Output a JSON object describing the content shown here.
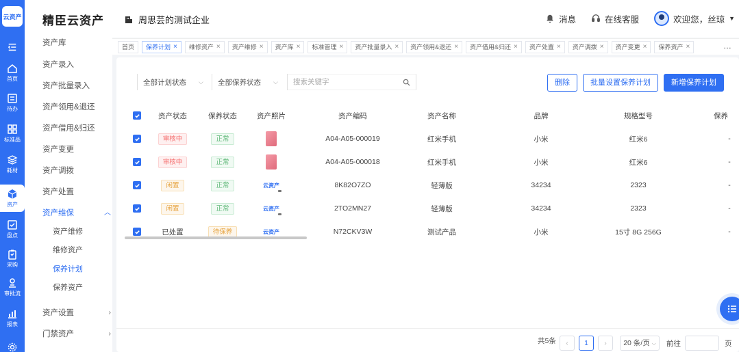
{
  "app": {
    "logo_text": "云资产",
    "brand": "精臣云资产",
    "company": "周思芸的测试企业"
  },
  "header": {
    "messages": "消息",
    "support": "在线客服",
    "welcome": "欢迎您，丝琼"
  },
  "rail": [
    {
      "label": "首页",
      "icon": "home-icon"
    },
    {
      "label": "待办",
      "icon": "todo-icon"
    },
    {
      "label": "标准品",
      "icon": "grid-icon"
    },
    {
      "label": "耗材",
      "icon": "layers-icon"
    },
    {
      "label": "资产",
      "icon": "cube-icon"
    },
    {
      "label": "盘点",
      "icon": "inventory-icon"
    },
    {
      "label": "采购",
      "icon": "clipboard-icon"
    },
    {
      "label": "审批流",
      "icon": "approval-icon"
    },
    {
      "label": "报表",
      "icon": "chart-icon"
    },
    {
      "label": "",
      "icon": "settings-icon"
    }
  ],
  "sidebar": {
    "items": [
      {
        "label": "资产库"
      },
      {
        "label": "资产录入"
      },
      {
        "label": "资产批量录入"
      },
      {
        "label": "资产领用&退还"
      },
      {
        "label": "资产借用&归还"
      },
      {
        "label": "资产变更"
      },
      {
        "label": "资产调拨"
      },
      {
        "label": "资产处置"
      },
      {
        "label": "资产维保"
      },
      {
        "label": "资产设置"
      },
      {
        "label": "门禁资产"
      }
    ],
    "subitems": [
      {
        "label": "资产维修"
      },
      {
        "label": "维修资产"
      },
      {
        "label": "保养计划"
      },
      {
        "label": "保养资产"
      }
    ]
  },
  "tabs": [
    {
      "label": "首页",
      "closable": false
    },
    {
      "label": "保养计划",
      "closable": true
    },
    {
      "label": "维修资产",
      "closable": true
    },
    {
      "label": "资产维修",
      "closable": true
    },
    {
      "label": "资产库",
      "closable": true
    },
    {
      "label": "标准管理",
      "closable": true
    },
    {
      "label": "资产批量录入",
      "closable": true
    },
    {
      "label": "资产领用&退还",
      "closable": true
    },
    {
      "label": "资产借用&归还",
      "closable": true
    },
    {
      "label": "资产处置",
      "closable": true
    },
    {
      "label": "资产调拨",
      "closable": true
    },
    {
      "label": "资产变更",
      "closable": true
    },
    {
      "label": "保养资产",
      "closable": true
    }
  ],
  "tabs_more": "…",
  "filters": {
    "plan_status": "全部计划状态",
    "maint_status": "全部保养状态",
    "search_placeholder": "搜索关键字"
  },
  "buttons": {
    "delete": "删除",
    "batch": "批量设置保养计划",
    "create": "新增保养计划"
  },
  "table": {
    "headers": [
      "资产状态",
      "保养状态",
      "资产照片",
      "资产编码",
      "资产名称",
      "品牌",
      "规格型号",
      "保养"
    ],
    "rows": [
      {
        "status": "审核中",
        "status_tone": "red",
        "maint": "正常",
        "maint_tone": "green",
        "photo": "phone",
        "code": "A04-A05-000019",
        "name": "红米手机",
        "brand": "小米",
        "model": "红米6",
        "extra": "-"
      },
      {
        "status": "审核中",
        "status_tone": "red",
        "maint": "正常",
        "maint_tone": "green",
        "photo": "phone",
        "code": "A04-A05-000018",
        "name": "红米手机",
        "brand": "小米",
        "model": "红米6",
        "extra": "-"
      },
      {
        "status": "闲置",
        "status_tone": "orange",
        "maint": "正常",
        "maint_tone": "green",
        "photo": "logo",
        "code": "8K82O7ZO",
        "name": "轻薄版",
        "brand": "34234",
        "model": "2323",
        "extra": "-"
      },
      {
        "status": "闲置",
        "status_tone": "orange",
        "maint": "正常",
        "maint_tone": "green",
        "photo": "logo",
        "code": "2TO2MN27",
        "name": "轻薄版",
        "brand": "34234",
        "model": "2323",
        "extra": "-"
      },
      {
        "status": "已处置",
        "status_tone": "plain",
        "maint": "待保养",
        "maint_tone": "orange",
        "photo": "logo",
        "code": "N72CKV3W",
        "name": "测试产品",
        "brand": "小米",
        "model": "15寸 8G 256G",
        "extra": "-"
      }
    ],
    "photo_logo_text": "云资产"
  },
  "pagination": {
    "total_label": "共5条",
    "current_page": "1",
    "page_size": "20 条/页",
    "goto_label": "前往",
    "goto_value": "",
    "page_suffix": "页"
  },
  "colors": {
    "accent": "#2f6ff2",
    "danger": "#f56c6c",
    "success": "#5fb878",
    "warning": "#e6a23c"
  }
}
